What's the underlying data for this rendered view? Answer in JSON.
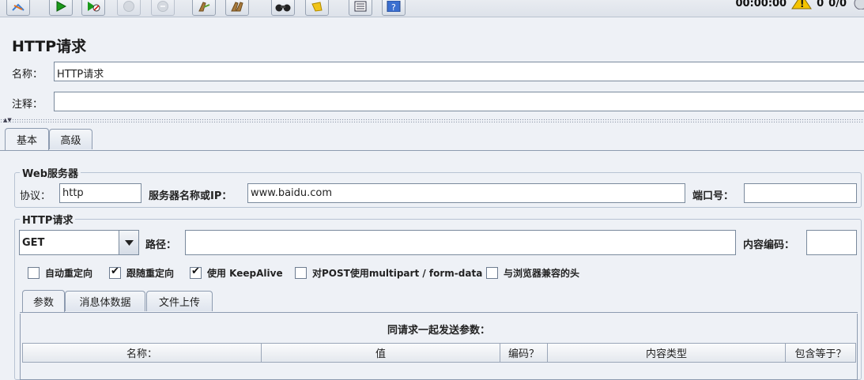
{
  "toolbar": {
    "buttons": [
      "remote-start-icon",
      "start-icon",
      "start-no-pause-icon",
      "stop-icon",
      "shutdown-icon",
      "clear-icon",
      "clear-all-icon",
      "search-icon",
      "reset-search-icon",
      "function-helper-icon",
      "help-icon"
    ],
    "elapsed_time": "00:00:00",
    "warning_count": "0",
    "thread_count": "0/0"
  },
  "page_title": "HTTP请求",
  "name_label": "名称：",
  "name_value": "HTTP请求",
  "comment_label": "注释：",
  "comment_value": "",
  "main_tabs": [
    "基本",
    "高级"
  ],
  "web_server": {
    "title": "Web服务器",
    "protocol_label": "协议：",
    "protocol_value": "http",
    "server_label": "服务器名称或IP：",
    "server_value": "www.baidu.com",
    "port_label": "端口号：",
    "port_value": ""
  },
  "http_request": {
    "title": "HTTP请求",
    "method": "GET",
    "path_label": "路径：",
    "path_value": "",
    "encoding_label": "内容编码：",
    "encoding_value": ""
  },
  "options": [
    {
      "label": "自动重定向",
      "checked": false
    },
    {
      "label": "跟随重定向",
      "checked": true
    },
    {
      "label": "使用 KeepAlive",
      "checked": true
    },
    {
      "label": "对POST使用multipart / form-data",
      "checked": false
    },
    {
      "label": "与浏览器兼容的头",
      "checked": false
    }
  ],
  "sub_tabs": [
    "参数",
    "消息体数据",
    "文件上传"
  ],
  "params": {
    "title": "同请求一起发送参数：",
    "columns": [
      "名称：",
      "值",
      "编码？",
      "内容类型",
      "包含等于？"
    ]
  },
  "colors": {
    "background": "#eef1f6",
    "border": "#8d9bb0",
    "warning": "#f5c400"
  }
}
